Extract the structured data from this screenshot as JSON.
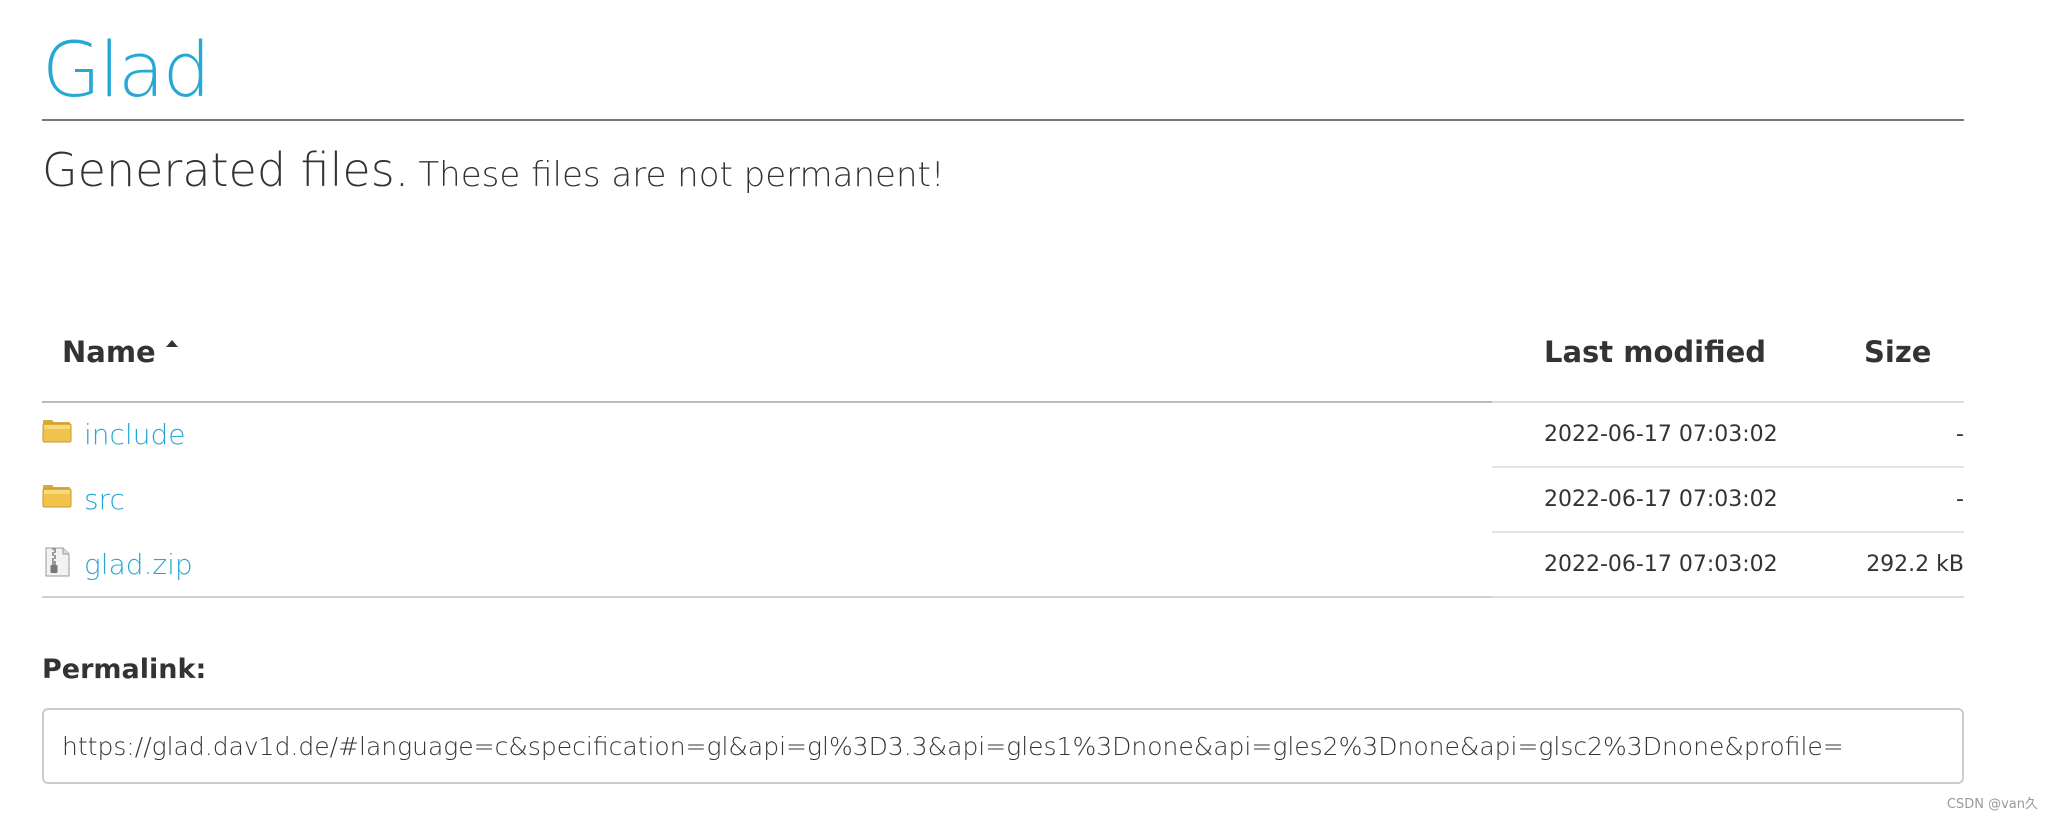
{
  "header": {
    "brand": "Glad"
  },
  "subtitle": {
    "main": "Generated files.",
    "note": "These files are not permanent!"
  },
  "table": {
    "columns": {
      "name": "Name",
      "modified": "Last modified",
      "size": "Size"
    },
    "sort": {
      "column": "name",
      "direction": "ascending"
    },
    "rows": [
      {
        "icon": "folder-icon",
        "name": "include",
        "modified": "2022-06-17 07:03:02",
        "size": "-"
      },
      {
        "icon": "folder-icon",
        "name": "src",
        "modified": "2022-06-17 07:03:02",
        "size": "-"
      },
      {
        "icon": "zip-file-icon",
        "name": "glad.zip",
        "modified": "2022-06-17 07:03:02",
        "size": "292.2 kB"
      }
    ]
  },
  "permalink": {
    "label": "Permalink:",
    "value": "https://glad.dav1d.de/#language=c&specification=gl&api=gl%3D3.3&api=gles1%3Dnone&api=gles2%3Dnone&api=glsc2%3Dnone&profile="
  },
  "watermark": {
    "text": "CSDN @van久"
  },
  "colors": {
    "link": "#27a8d4",
    "text": "#333333",
    "rule": "#777777",
    "folder": "#f1c24c"
  }
}
